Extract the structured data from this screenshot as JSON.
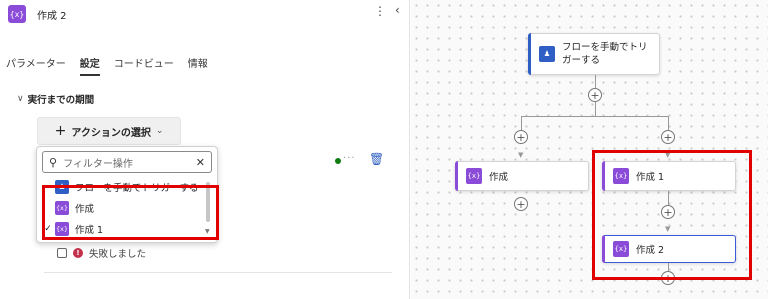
{
  "header": {
    "icon": "{x}",
    "title": "作成 2",
    "more": "⋮",
    "collapse": "‹"
  },
  "tabs": [
    "パラメーター",
    "設定",
    "コードビュー",
    "情報"
  ],
  "section": {
    "chevron": "∨",
    "title": "実行までの期間"
  },
  "action_button": {
    "plus": "+",
    "label": "アクションの選択",
    "chevron": "⌄"
  },
  "filter": {
    "placeholder": "フィルター操作",
    "clear": "✕"
  },
  "options": [
    {
      "label": "フローを手動でトリガーする",
      "icon": "person-icon",
      "checked": false
    },
    {
      "label": "作成",
      "icon": "{x}",
      "checked": false
    },
    {
      "label": "作成 1",
      "icon": "{x}",
      "checked": true
    }
  ],
  "check_mark": "✓",
  "status": {
    "more": "···",
    "delete": "🗑"
  },
  "failed": {
    "label": "失敗しました",
    "icon": "!"
  },
  "flow": {
    "trigger": {
      "line1": "フローを手動でトリ",
      "line2": "ガーする"
    },
    "node_left": "作成",
    "node_mid": "作成 1",
    "node_bottom": "作成 2",
    "node_icon": "{x}",
    "plus": "+"
  },
  "colors": {
    "accent_purple": "#8a4cd8",
    "trigger_blue": "#2f5fc4",
    "highlight": "#e00000",
    "success": "#107c10",
    "fail": "#c4314b"
  }
}
